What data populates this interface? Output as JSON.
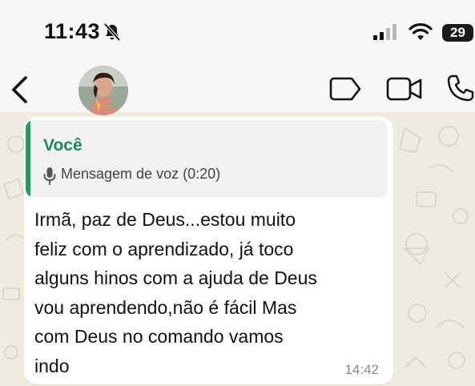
{
  "status_bar": {
    "time": "11:43",
    "battery": "29",
    "icons": [
      "bell-off-icon",
      "signal-icon",
      "wifi-icon",
      "battery-icon"
    ]
  },
  "chat_header": {
    "icons": [
      "back-icon",
      "avatar",
      "label-icon",
      "video-call-icon",
      "phone-call-icon"
    ]
  },
  "message": {
    "quoted": {
      "author": "Você",
      "text": "Mensagem de voz (0:20)",
      "icon": "microphone-icon"
    },
    "text": "Irmã, paz de Deus...estou muito\nfeliz com o aprendizado, já toco\nalguns hinos com a ajuda de Deus\nvou aprendendo,não é fácil Mas\ncom Deus no comando  vamos\nindo",
    "time": "14:42"
  },
  "colors": {
    "quote_accent": "#1f9d63",
    "author_name": "#1f8a57",
    "wallpaper": "#efeae2",
    "bubble": "#ffffff"
  }
}
